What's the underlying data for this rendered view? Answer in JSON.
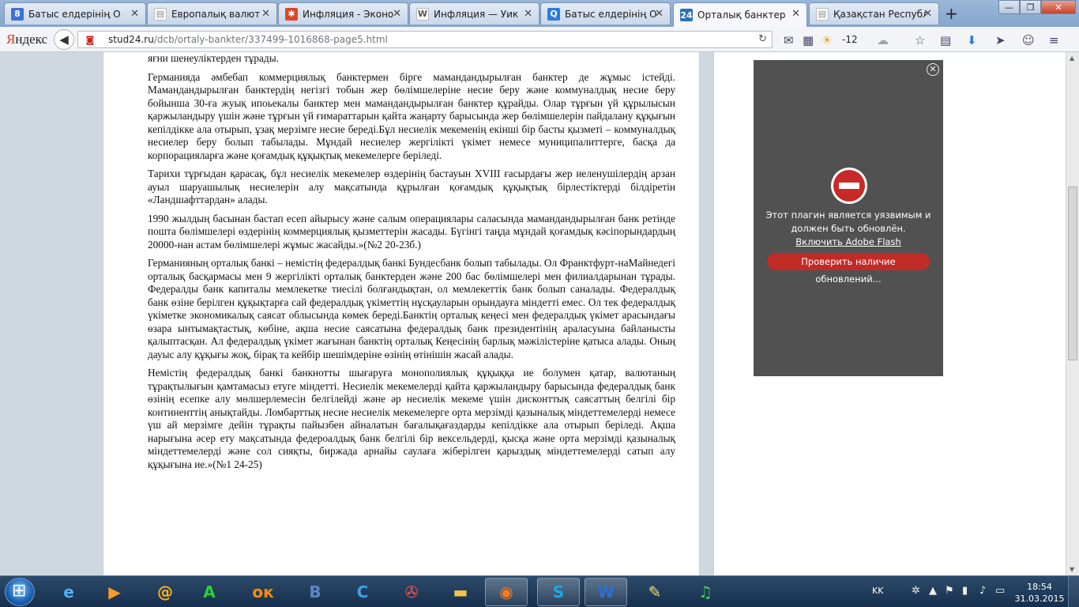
{
  "tabs": [
    {
      "label": "Батыс елдерінің О",
      "icon": "g-icon",
      "icon_text": "8",
      "icon_color": "#3d6fd6"
    },
    {
      "label": "Европалық валют",
      "icon": "document-icon",
      "icon_text": "▤",
      "icon_color": "#8a8a8a"
    },
    {
      "label": "Инфляция - Эконо",
      "icon": "colorful-logo-icon",
      "icon_text": "✱",
      "icon_color": "#d9472b"
    },
    {
      "label": "Инфляция — Уик",
      "icon": "wikipedia-icon",
      "icon_text": "W",
      "icon_color": "#555555"
    },
    {
      "label": "Батыс елдерінің О",
      "icon": "search-icon",
      "icon_text": "Q",
      "icon_color": "#2a7be0"
    },
    {
      "label": "Орталық банктер",
      "icon": "site-24-icon",
      "icon_text": "24",
      "icon_color": "#2e6fb8"
    },
    {
      "label": "Қазақстан Республ",
      "icon": "document-icon",
      "icon_text": "▤",
      "icon_color": "#8a8a8a"
    }
  ],
  "new_tab": "+",
  "window_buttons": {
    "minimize": "—",
    "restore": "❐",
    "close": "✕"
  },
  "browser": {
    "brand_first": "Я",
    "brand_rest": "ндекс",
    "url_host": "stud24.ru",
    "url_path": "/dcb/ortaly-bankter/337499-1016868-page5.html",
    "weather_temp": "-12"
  },
  "article": {
    "lead": "яғни шенеуліктерден  тұрады.",
    "paragraphs": [
      "Германияда  әмбебап коммерциялық банктермен бірге  мамандандырылған банктер де жұмыс істейді. Мамандандырылған  банктердің негізгі  тобын жер бөлімшелеріне  несие беру және коммуналдық несие  беру бойынша 30-ға жуық ипоьекалы банктер  мен мамандандырылған банктер құрайды. Олар тұрғын үй құрылысын қаржыландыру үшін және тұрғын үй ғимараттарын қайта жаңарту барысында жер бөлімшелерін пайдалану құқығын кепілдікке ала отырып, ұзақ мерзімге несие береді.Бұл несиелік мекеменің екінші бір басты қызметі – коммуналдық несиелер беру болып табылады. Мұндай несиелер жергілікті үкімет немесе муниципалиттерге, басқа да корпорацияларға және қоғамдық құқықтық мекемелерге беріледі.",
      "Тарихи   тұрғыдан қарасақ, бұл несиелік мекемелер   өздерінің бастауын XVIII ғасырдағы  жер иеленушілердің арзан ауыл шаруашылық несиелерін алу мақсатында құрылған қоғамдық құқықтық бірлестіктерді білдіретін «Ландшафттардан» алады.",
      "1990 жылдың   басынан бастап есеп айырысу   және салым операциялары саласында  мамандандырылған банк ретінде  пошта бөлімшелері өздерінің  коммерциялық қызметтерін жасады. Бүгінгі   таңда   мұндай   қоғамдық   кәсіпорындардың   20000-нан   астам бөлімшелері жұмыс жасайды.»(№2 20-23б.)",
      "Германияның орталық банкі –  немістің федералдық банкі Бундесбанк болып табылады. Ол Франктфурт-наМайнедегі орталық басқармасы мен 9 жергілікті орталық банктерден  және 200 бас бөлімшелері мен филиалдарынан тұрады. Федералды банк капиталы мемлекетке тиесілі болғандықтан, ол мемлекеттік банк болып саналады. Федералдық банк өзіне берілген құқықтарға сай федералдық үкіметтің нұсқауларын орындауға міндетті емес. Ол тек федералдық үкіметке экономикалық саясат облысында көмек береді.Банктің орталық кеңесі мен федералдық үкімет арасындағы өзара ынтымақтастық, көбіне, ақша несие саясатына федералдық  банк президентінің араласуына байланысты қалыптасқан. Ал федералдық үкімет жағынан банктің орталық Кеңесінің барлық мәжілістеріне қатыса алады. Оның дауыс алу құқығы жоқ, бірақ та кейбір шешімдеріне өзінің өтінішін жасай алады.",
      "Немістің   федералдық банкі банкнотты шығаруға монополиялық құқыққа ие болумен   қатар, валютаның тұрақтылығын қамтамасыз етуге міндетті. Несиелік мекемелерді  қайта қаржыландыру барысында федералдық банк өзінің есепке алу мөлшерлемесін  белгілейді және  әр несиелік мекеме үшін дисконттық саясаттың белгілі  бір континенттің анықтайды. Ломбарттық несие несиелік мекемелерге орта мерзімді қазыналық міндеттемелерді  немесе үш ай мерзімге дейін тұрақты  пайызбен айналатын бағалықағаздарды кепілдікке ала отырып беріледі. Ақша нарығына әсер ету мақсатында федероалдық   банк белгілі бір вексельдерді, қысқа   және орта мерзімді қазыналық міндеттемелерді   және сол сияқты, биржада арнайы саулаға жіберілген қарыздық міндеттемелерді  сатып алу құқығына ие.»(№1 24-25)"
    ]
  },
  "flash": {
    "message_line1": "Этот плагин является уязвимым и",
    "message_line2": "должен быть обновлён.",
    "enable_link": "Включить Adobe Flash",
    "update_button": "Проверить наличие обновлений..."
  },
  "taskbar": {
    "apps": [
      {
        "name": "ie",
        "glyph": "e",
        "color": "#4fb3ff"
      },
      {
        "name": "media-player",
        "glyph": "▶",
        "color": "#ff9a2a"
      },
      {
        "name": "mail-agent",
        "glyph": "@",
        "color": "#ffb020"
      },
      {
        "name": "green-a",
        "glyph": "A",
        "color": "#2bd13a"
      },
      {
        "name": "odnoklassniki",
        "glyph": "ок",
        "color": "#ff8a00"
      },
      {
        "name": "vkontakte",
        "glyph": "B",
        "color": "#5c87c6"
      },
      {
        "name": "ccleaner",
        "glyph": "C",
        "color": "#3ea0e8"
      },
      {
        "name": "tool",
        "glyph": "✇",
        "color": "#ff5050"
      },
      {
        "name": "explorer",
        "glyph": "▬",
        "color": "#f2c24a"
      },
      {
        "name": "firefox",
        "glyph": "◉",
        "color": "#ff7a1c"
      },
      {
        "name": "skype",
        "glyph": "S",
        "color": "#19a8e8"
      },
      {
        "name": "word",
        "glyph": "W",
        "color": "#2f6fd1"
      },
      {
        "name": "paint",
        "glyph": "✎",
        "color": "#f3e070"
      },
      {
        "name": "music",
        "glyph": "♫",
        "color": "#43d04a"
      }
    ],
    "lang": "KK",
    "time": "18:54",
    "date": "31.03.2015"
  }
}
